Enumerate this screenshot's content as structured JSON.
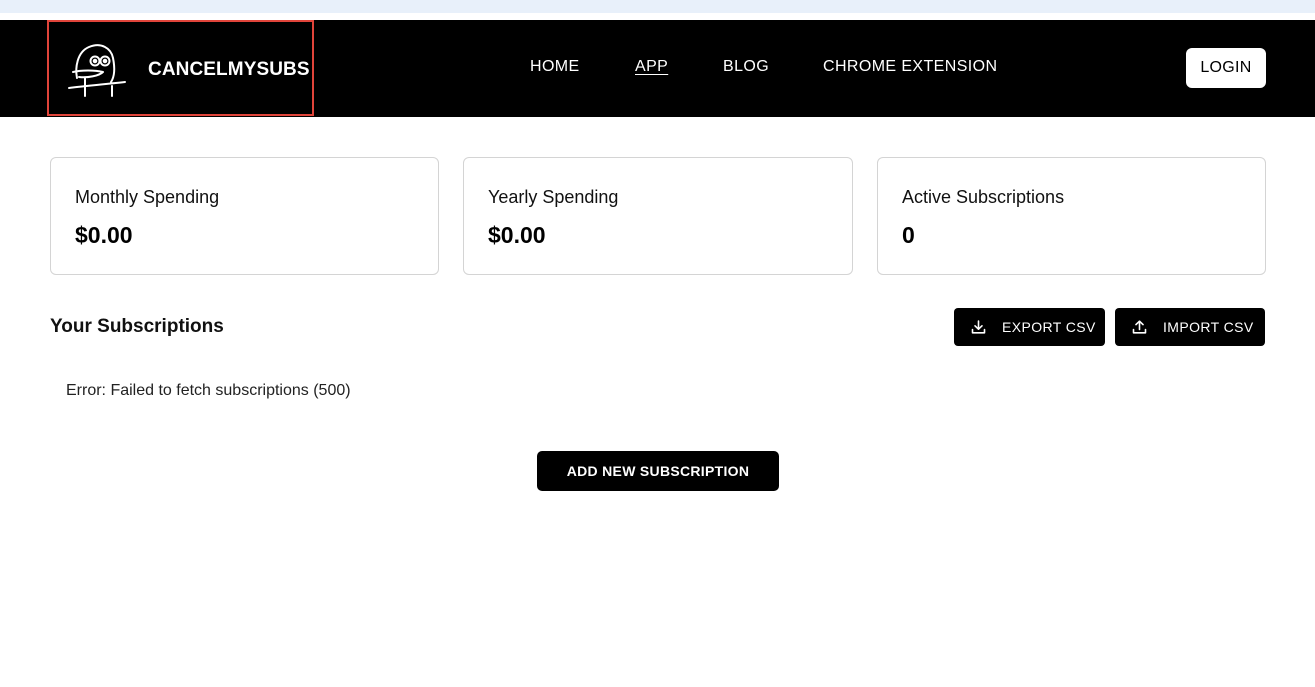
{
  "nav": {
    "brand_name": "CANCELMYSUBS",
    "links": [
      {
        "label": "HOME",
        "active": false
      },
      {
        "label": "APP",
        "active": true
      },
      {
        "label": "BLOG",
        "active": false
      },
      {
        "label": "CHROME EXTENSION",
        "active": false
      }
    ],
    "login_label": "LOGIN"
  },
  "stats": {
    "monthly": {
      "label": "Monthly Spending",
      "value": "$0.00"
    },
    "yearly": {
      "label": "Yearly Spending",
      "value": "$0.00"
    },
    "active": {
      "label": "Active Subscriptions",
      "value": "0"
    }
  },
  "subscriptions": {
    "title": "Your Subscriptions",
    "export_label": "EXPORT CSV",
    "import_label": "IMPORT CSV",
    "error": "Error: Failed to fetch subscriptions (500)",
    "add_label": "ADD NEW SUBSCRIPTION"
  },
  "icons": {
    "logo": "ghost-face-logo-icon",
    "export": "download-icon",
    "import": "upload-icon"
  },
  "colors": {
    "navbar": "#000000",
    "highlight_border": "#e0443a",
    "top_strip": "#e8f0fa"
  }
}
